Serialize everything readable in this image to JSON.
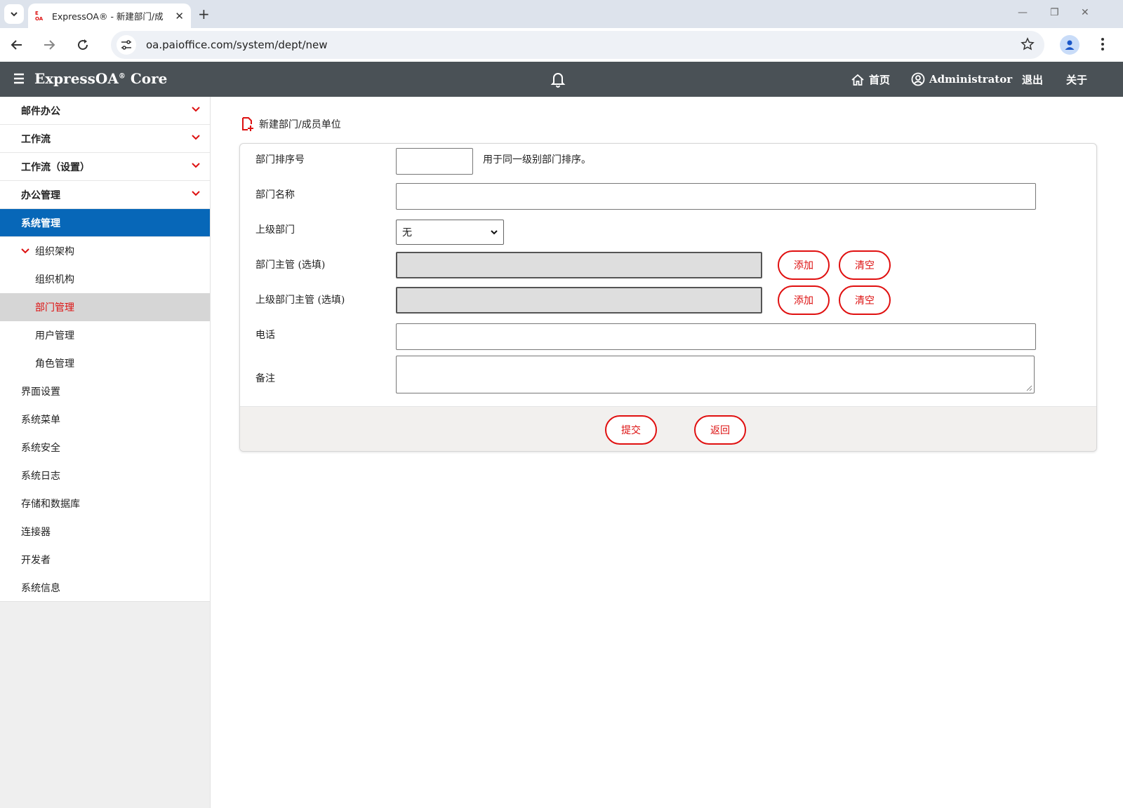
{
  "browser": {
    "tab_title": "ExpressOA® - 新建部门/成",
    "favicon_text_top": "E",
    "favicon_text_bottom": "OA",
    "url": "oa.paioffice.com/system/dept/new"
  },
  "header": {
    "brand": "ExpressOA",
    "brand_mark": "®",
    "brand_suffix": " Core",
    "home_label": "首页",
    "user_label": "Administrator",
    "logout_label": "退出",
    "about_label": "关于"
  },
  "sidebar": {
    "sections": [
      "邮件办公",
      "工作流",
      "工作流（设置）",
      "办公管理"
    ],
    "active_section": "系统管理",
    "group_label": "组织架构",
    "group_items": [
      "组织机构",
      "部门管理",
      "用户管理",
      "角色管理"
    ],
    "other_items": [
      "界面设置",
      "系统菜单",
      "系统安全",
      "系统日志",
      "存储和数据库",
      "连接器",
      "开发者",
      "系统信息"
    ]
  },
  "page": {
    "title": "新建部门/成员单位"
  },
  "form": {
    "order_label": "部门排序号",
    "order_value": "",
    "order_hint": "用于同一级别部门排序。",
    "name_label": "部门名称",
    "name_value": "",
    "parent_label": "上级部门",
    "parent_value": "无",
    "manager_label": "部门主管 (选填)",
    "parent_manager_label": "上级部门主管 (选填)",
    "phone_label": "电话",
    "phone_value": "",
    "remark_label": "备注",
    "add_label": "添加",
    "clear_label": "清空",
    "submit_label": "提交",
    "back_label": "返回"
  },
  "colors": {
    "header_bg": "#4a5156",
    "active_nav": "#0767b8",
    "accent_red": "#e01010"
  }
}
